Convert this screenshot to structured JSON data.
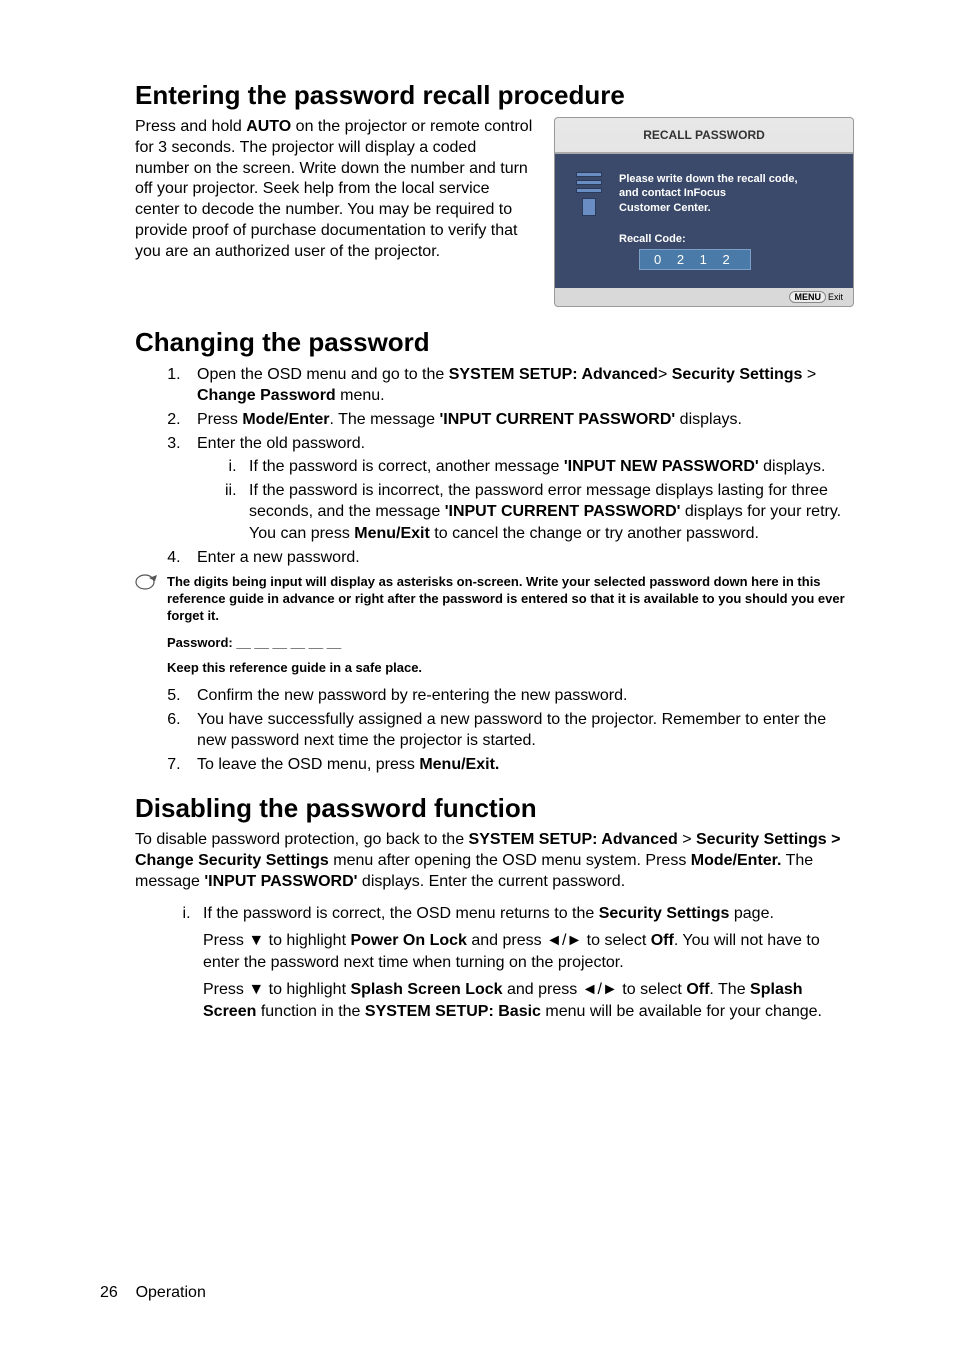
{
  "section1": {
    "title": "Entering the password recall procedure",
    "intro": "Press and hold ",
    "intro_bold": "AUTO",
    "intro_after": " on the projector or remote control for 3 seconds. The projector will display a coded number on the screen. Write down the number and turn off your projector. Seek help from the local service center to decode the number. You may be required to provide proof of purchase documentation to verify that you are an authorized user of the projector."
  },
  "recall": {
    "header": "RECALL PASSWORD",
    "msg1": "Please write down the recall code,",
    "msg2": "and contact InFocus",
    "msg3": "Customer Center.",
    "code_label": "Recall Code:",
    "code_val": "0 2 1 2",
    "menu": "MENU",
    "exit": "Exit"
  },
  "section2": {
    "title": "Changing the password",
    "item1_a": "Open the OSD menu and go to the ",
    "item1_b": "SYSTEM SETUP: Advanced",
    "item1_c": "> ",
    "item1_d": "Security Settings",
    "item1_e": " > ",
    "item1_f": "Change Password",
    "item1_g": " menu.",
    "item2_a": "Press ",
    "item2_b": "Mode/Enter",
    "item2_c": ". The message ",
    "item2_d": "'INPUT CURRENT PASSWORD'",
    "item2_e": " displays.",
    "item3": "Enter the old password.",
    "item3_i_a": "If the password is correct, another message ",
    "item3_i_b": "'INPUT NEW PASSWORD'",
    "item3_i_c": " displays.",
    "item3_ii_a": "If the password is incorrect, the password error message displays lasting for three seconds, and the message ",
    "item3_ii_b": "'INPUT CURRENT PASSWORD'",
    "item3_ii_c": " displays for your retry. You can press ",
    "item3_ii_d": "Menu/Exit",
    "item3_ii_e": " to cancel the change or try another password.",
    "item4": "Enter a new password.",
    "note": "The digits being input will display as asterisks on-screen. Write your selected password down here in this reference guide in advance or right after the password is entered so that it is available to you should you ever forget it.",
    "password_label": "Password: __ __ __ __ __ __",
    "keep": "Keep this reference guide in a safe place.",
    "item5": "Confirm the new password by re-entering the new password.",
    "item6": "You have successfully assigned a new password to the projector. Remember to enter the new password next time the projector is started.",
    "item7_a": "To leave the OSD menu, press ",
    "item7_b": "Menu/Exit."
  },
  "section3": {
    "title": "Disabling the password function",
    "p1_a": "To disable password protection, go back to the ",
    "p1_b": "SYSTEM SETUP: Advanced",
    "p1_c": " > ",
    "p1_d": "Security Settings > Change Security Settings",
    "p1_e": " menu after opening the OSD menu system. Press ",
    "p1_f": "Mode/Enter.",
    "p1_g": " The message ",
    "p1_h": "'INPUT PASSWORD'",
    "p1_i": " displays. Enter the current password.",
    "i_a": "If the password is correct, the OSD menu returns to the ",
    "i_b": "Security Settings",
    "i_c": " page.",
    "i_p2_a": "Press ",
    "i_p2_b": " to highlight ",
    "i_p2_c": "Power On Lock",
    "i_p2_d": " and press ",
    "i_p2_e": "  to select ",
    "i_p2_f": "Off",
    "i_p2_g": ". You will not have to enter the password next time when turning on the projector.",
    "i_p3_a": "Press ",
    "i_p3_b": " to highlight ",
    "i_p3_c": "Splash Screen Lock",
    "i_p3_d": " and press ",
    "i_p3_e": "  to select ",
    "i_p3_f": "Off",
    "i_p3_g": ". The ",
    "i_p3_h": "Splash Screen",
    "i_p3_i": " function in the ",
    "i_p3_j": "SYSTEM SETUP: Basic",
    "i_p3_k": " menu will be available for your change."
  },
  "footer": {
    "page": "26",
    "label": "Operation"
  }
}
